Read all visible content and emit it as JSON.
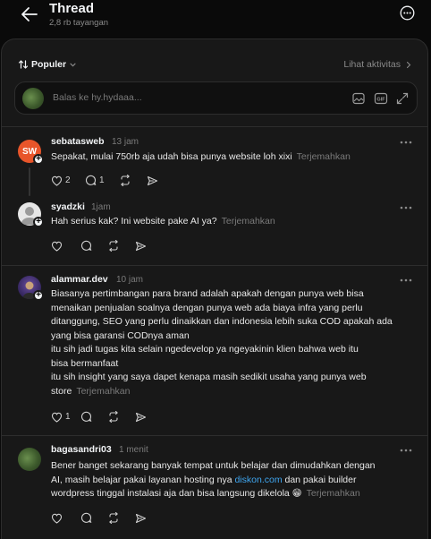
{
  "header": {
    "title": "Thread",
    "views": "2,8 rb tayangan"
  },
  "toolbar": {
    "sort_label": "Populer",
    "activity_label": "Lihat aktivitas"
  },
  "reply": {
    "placeholder": "Balas ke hy.hydaaa..."
  },
  "posts": [
    {
      "username": "sebatasweb",
      "time": "13 jam",
      "text": "Sepakat, mulai 750rb aja udah bisa punya website loh xixi",
      "translate": "Terjemahkan",
      "likes": "2",
      "replies": "1",
      "avatar_text": "SW",
      "avatar_color": "#e8552a"
    },
    {
      "username": "syadzki",
      "time": "1jam",
      "text": "Hah serius kak? Ini website pake AI ya?",
      "translate": "Terjemahkan"
    },
    {
      "username": "alammar.dev",
      "time": "10 jam",
      "text_lines": [
        "Biasanya pertimbangan para brand adalah apakah dengan punya web bisa",
        "menaikan penjualan soalnya dengan punya web ada biaya infra yang perlu",
        "ditanggung, SEO yang perlu dinaikkan dan indonesia lebih suka COD apakah ada",
        "yang bisa garansi CODnya aman",
        "itu sih jadi tugas kita selain ngedevelop ya ngeyakinin klien bahwa web itu",
        "bisa bermanfaat",
        "itu sih insight yang saya dapet kenapa masih sedikit usaha yang punya web",
        "store"
      ],
      "translate": "Terjemahkan",
      "likes": "1"
    },
    {
      "username": "bagasandri03",
      "time": "1 menit",
      "text_line1": "Bener banget sekarang banyak tempat untuk belajar dan dimudahkan dengan",
      "text_line2_a": "AI, masih belajar pakai layanan hosting nya",
      "text_line2_link": "diskon.com",
      "text_line2_b": "dan pakai builder",
      "text_line3": "wordpress tinggal instalasi aja dan bisa langsung dikelola 😁",
      "translate": "Terjemahkan"
    }
  ],
  "colors": {
    "background": "#0a0a0a",
    "panel": "#181818",
    "link": "#3fa6f0",
    "muted": "#7a7a7a"
  }
}
